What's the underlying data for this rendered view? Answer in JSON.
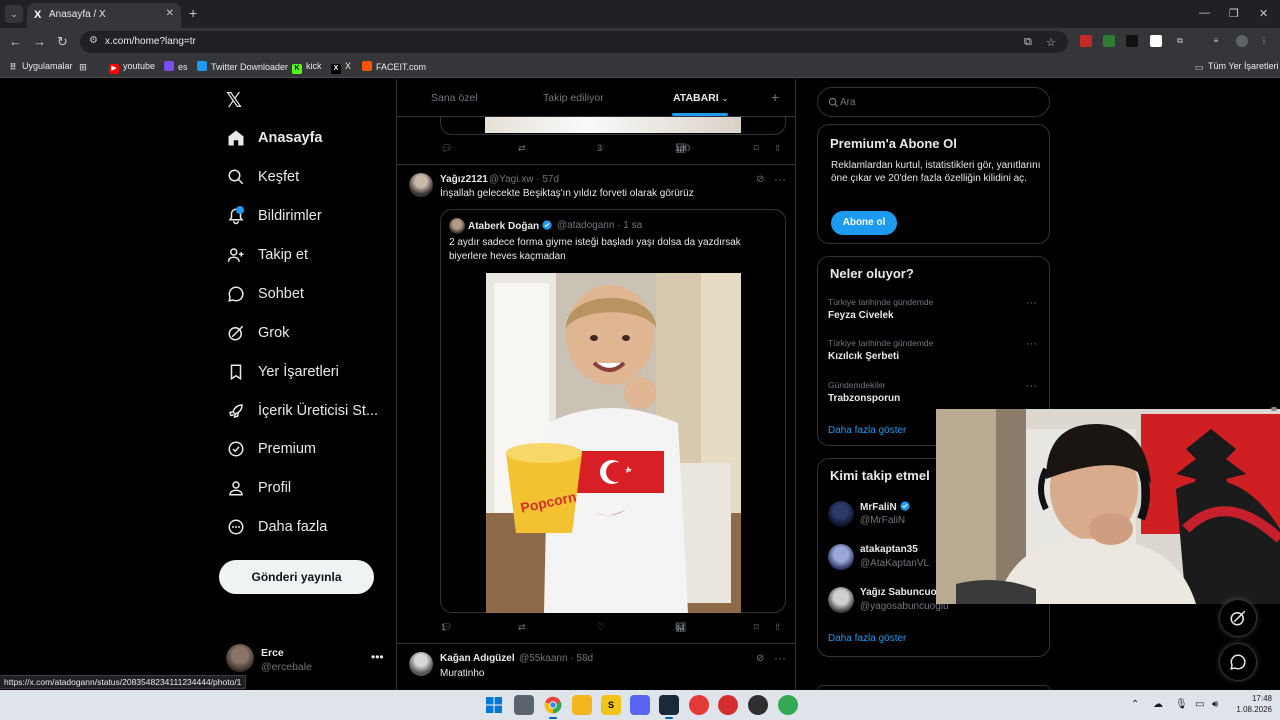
{
  "browser": {
    "tab_title": "Anasayfa / X",
    "tab_favicon": "X",
    "url": "x.com/home?lang=tr",
    "bookmarks": [
      {
        "label": "Uygulamalar",
        "icon": "apps-grid-icon"
      },
      {
        "label": "youtube",
        "icon": "youtube-icon",
        "color": "#ff0000"
      },
      {
        "label": "es",
        "icon": "es-icon",
        "color": "#7b4df2"
      },
      {
        "label": "Twitter Downloader",
        "icon": "twitter-downloader-icon",
        "color": "#1d9bf0"
      },
      {
        "label": "kick",
        "icon": "kick-icon",
        "color": "#53fc18"
      },
      {
        "label": "X",
        "icon": "x-icon",
        "color": "#000000"
      },
      {
        "label": "FACEIT.com",
        "icon": "faceit-icon",
        "color": "#ff5500"
      }
    ],
    "all_bookmarks": "Tüm Yer İşaretleri",
    "status_url": "https://x.com/atadogann/status/2083548234111234444/photo/1"
  },
  "nav": {
    "logo": "𝕏",
    "items": [
      {
        "label": "Anasayfa",
        "icon": "home-icon",
        "active": true
      },
      {
        "label": "Keşfet",
        "icon": "search-icon"
      },
      {
        "label": "Bildirimler",
        "icon": "bell-icon"
      },
      {
        "label": "Takip et",
        "icon": "follow-icon"
      },
      {
        "label": "Sohbet",
        "icon": "chat-icon"
      },
      {
        "label": "Grok",
        "icon": "grok-icon"
      },
      {
        "label": "Yer İşaretleri",
        "icon": "bookmark-icon"
      },
      {
        "label": "İçerik Üreticisi St...",
        "icon": "rocket-icon"
      },
      {
        "label": "Premium",
        "icon": "premium-icon"
      },
      {
        "label": "Profil",
        "icon": "profile-icon"
      },
      {
        "label": "Daha fazla",
        "icon": "more-icon"
      }
    ],
    "post_button": "Gönderi yayınla",
    "user": {
      "name": "Erce",
      "handle": "@ercebale"
    }
  },
  "timeline": {
    "tabs": [
      "Sana özel",
      "Takip ediliyor",
      "ATABARI"
    ],
    "prev_post_actions": {
      "replies": "",
      "reposts": "",
      "likes": "3",
      "views": "100"
    },
    "post1": {
      "name": "Yağız2121",
      "handle": "@Yagi.xw",
      "time": "· 57d",
      "text": "İnşallah gelecekte Beşiktaş'ın yıldız forveti olarak görürüz",
      "quote": {
        "name": "Ataberk Doğan",
        "handle": "@atadogann",
        "time": "· 1 sa",
        "text": "2 aydır sadece forma giyme isteği başladı yaşı dolsa da yazdırsak biyerlere heves kaçmadan",
        "photo_text": "Popcorn"
      },
      "actions": {
        "replies": "1",
        "reposts": "",
        "likes": "",
        "views": "87"
      }
    },
    "post2": {
      "name": "Kağan Adıgüzel",
      "handle": "@55kaann",
      "time": "· 58d",
      "text": "Muratinho"
    }
  },
  "sidebar": {
    "search_placeholder": "Ara",
    "premium": {
      "title": "Premium'a Abone Ol",
      "text": "Reklamlardan kurtul, istatistikleri gör, yanıtlarını öne çıkar ve 20'den fazla özelliğin kilidini aç.",
      "button": "Abone ol"
    },
    "trends": {
      "title": "Neler oluyor?",
      "items": [
        {
          "context": "Türkiye tarihinde gündemde",
          "name": "Feyza Civelek"
        },
        {
          "context": "Türkiye tarihinde gündemde",
          "name": "Kızılcık Şerbeti"
        },
        {
          "context": "Gündemdekiler",
          "name": "Trabzonsporun"
        }
      ],
      "more": "Daha fazla göster"
    },
    "who_to_follow": {
      "title": "Kimi takip etmel",
      "users": [
        {
          "name": "MrFaliN",
          "handle": "@MrFaliN",
          "verified": true
        },
        {
          "name": "atakaptan35",
          "handle": "@AtaKaptanVL",
          "verified": false
        },
        {
          "name": "Yağız Sabuncuo",
          "handle": "@yagosabuncuoglu",
          "verified": false
        }
      ],
      "more": "Daha fazla göster"
    }
  },
  "taskbar": {
    "time": "17:48",
    "date": "1.08.2026",
    "apps": [
      {
        "name": "start",
        "color": "#0078d4"
      },
      {
        "name": "task-view",
        "color": "#5c6370"
      },
      {
        "name": "chrome",
        "color": "#e8453c"
      },
      {
        "name": "file-explorer",
        "color": "#f3b61f"
      },
      {
        "name": "app-s",
        "label": "S",
        "color": "#f0c419"
      },
      {
        "name": "discord",
        "color": "#5865f2"
      },
      {
        "name": "steam",
        "color": "#1b2838"
      },
      {
        "name": "media-player",
        "color": "#e53935"
      },
      {
        "name": "app-red",
        "color": "#d32f2f"
      },
      {
        "name": "obs",
        "color": "#302e31"
      },
      {
        "name": "chrome-2",
        "color": "#34a853"
      }
    ]
  },
  "colors": {
    "accent": "#1d9bf0",
    "background": "#000000",
    "border": "#2f3336",
    "muted": "#71767b"
  }
}
